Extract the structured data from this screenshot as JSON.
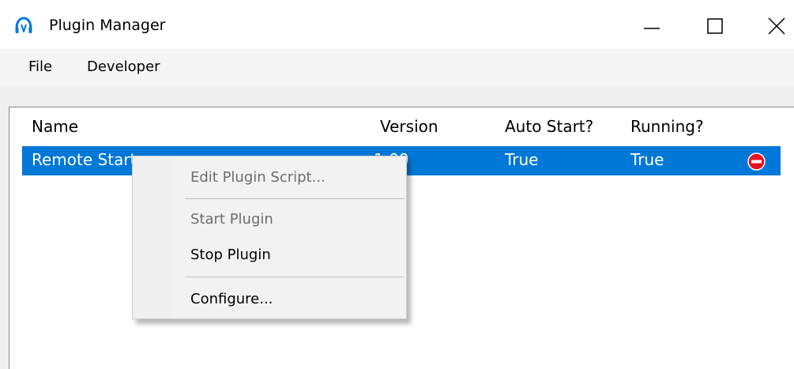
{
  "window": {
    "title": "Plugin Manager",
    "app_icon": "headset-icon",
    "controls": {
      "minimize_icon": "minimize-icon",
      "maximize_icon": "maximize-icon",
      "close_icon": "close-icon"
    }
  },
  "menubar": {
    "items": [
      {
        "label": "File"
      },
      {
        "label": "Developer"
      }
    ]
  },
  "table": {
    "columns": [
      "Name",
      "Version",
      "Auto Start?",
      "Running?"
    ],
    "rows": [
      {
        "name": "Remote Start",
        "version": "1.00",
        "auto_start": "True",
        "running": "True",
        "status_icon": "stop-circle-icon",
        "selected": true
      }
    ]
  },
  "context_menu": {
    "items": [
      {
        "label": "Edit Plugin Script...",
        "enabled": false
      },
      {
        "label": "Start Plugin",
        "enabled": false
      },
      {
        "label": "Stop Plugin",
        "enabled": true
      },
      {
        "label": "Configure...",
        "enabled": true
      }
    ]
  },
  "colors": {
    "selection": "#0078d7",
    "status_icon_red": "#e81123",
    "icon_blue": "#0078d7"
  }
}
